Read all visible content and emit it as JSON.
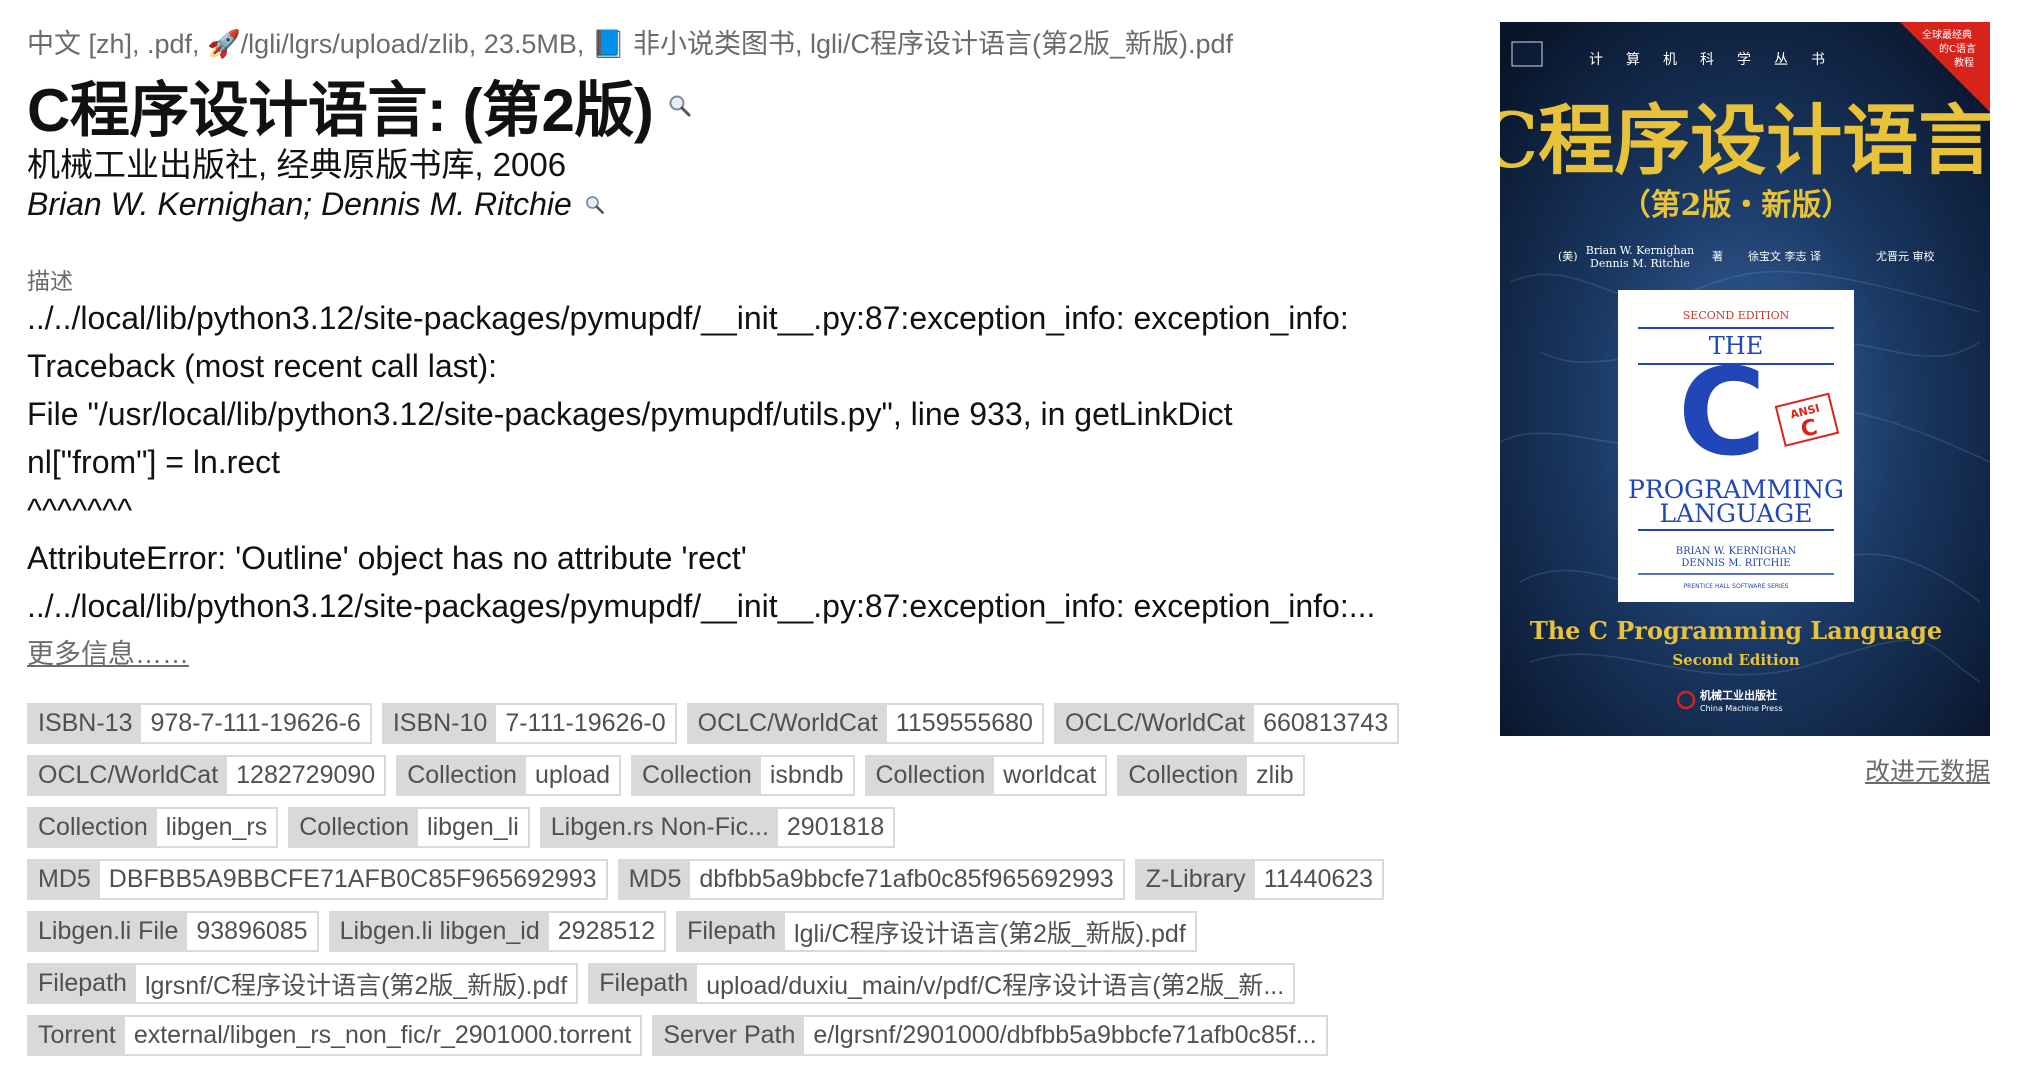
{
  "meta_line": "中文 [zh], .pdf, 🚀/lgli/lgrs/upload/zlib, 23.5MB, 📘 非小说类图书, lgli/C程序设计语言(第2版_新版).pdf",
  "title": "C程序设计语言: (第2版)",
  "publisher": "机械工业出版社, 经典原版书库, 2006",
  "authors": "Brian W. Kernighan; Dennis M. Ritchie",
  "description_label": "描述",
  "description_lines": [
    "../../local/lib/python3.12/site-packages/pymupdf/__init__.py:87:exception_info: exception_info:",
    "Traceback (most recent call last):",
    "File \"/usr/local/lib/python3.12/site-packages/pymupdf/utils.py\", line 933, in getLinkDict",
    "nl[\"from\"] = ln.rect",
    "^^^^^^^",
    "AttributeError: 'Outline' object has no attribute 'rect'",
    "../../local/lib/python3.12/site-packages/pymupdf/__init__.py:87:exception_info: exception_info:..."
  ],
  "more_link": "更多信息……",
  "improve_link": "改进元数据",
  "tags": [
    [
      {
        "k": "ISBN-13",
        "v": "978-7-111-19626-6"
      },
      {
        "k": "ISBN-10",
        "v": "7-111-19626-0"
      },
      {
        "k": "OCLC/WorldCat",
        "v": "1159555680"
      },
      {
        "k": "OCLC/WorldCat",
        "v": "660813743"
      }
    ],
    [
      {
        "k": "OCLC/WorldCat",
        "v": "1282729090"
      },
      {
        "k": "Collection",
        "v": "upload"
      },
      {
        "k": "Collection",
        "v": "isbndb"
      },
      {
        "k": "Collection",
        "v": "worldcat"
      },
      {
        "k": "Collection",
        "v": "zlib"
      }
    ],
    [
      {
        "k": "Collection",
        "v": "libgen_rs"
      },
      {
        "k": "Collection",
        "v": "libgen_li"
      },
      {
        "k": "Libgen.rs Non-Fic...",
        "v": "2901818"
      }
    ],
    [
      {
        "k": "MD5",
        "v": "DBFBB5A9BBCFE71AFB0C85F965692993"
      },
      {
        "k": "MD5",
        "v": "dbfbb5a9bbcfe71afb0c85f965692993"
      },
      {
        "k": "Z-Library",
        "v": "11440623"
      }
    ],
    [
      {
        "k": "Libgen.li File",
        "v": "93896085"
      },
      {
        "k": "Libgen.li libgen_id",
        "v": "2928512"
      },
      {
        "k": "Filepath",
        "v": "lgli/C程序设计语言(第2版_新版).pdf"
      }
    ],
    [
      {
        "k": "Filepath",
        "v": "lgrsnf/C程序设计语言(第2版_新版).pdf"
      },
      {
        "k": "Filepath",
        "v": "upload/duxiu_main/v/pdf/C程序设计语言(第2版_新..."
      }
    ],
    [
      {
        "k": "Torrent",
        "v": "external/libgen_rs_non_fic/r_2901000.torrent"
      },
      {
        "k": "Server Path",
        "v": "e/lgrsnf/2901000/dbfbb5a9bbcfe71afb0c85f..."
      }
    ]
  ],
  "cover": {
    "series_chars": [
      "计",
      "算",
      "机",
      "科",
      "学",
      "丛",
      "书"
    ],
    "corner_badge": [
      "全球最经典",
      "的C语言",
      "教程"
    ],
    "cn_title": "C程序设计语言",
    "cn_edition": "（第2版・新版）",
    "authors_en": [
      "Brian W. Kernighan",
      "Dennis M. Ritchie"
    ],
    "author_prefix": "(美)",
    "author_suffix": "著",
    "translators": "徐宝文  李志  译",
    "reviewer": "尤晋元  审校",
    "inner_edition": "SECOND EDITION",
    "inner_the": "THE",
    "inner_c": "C",
    "inner_ansi": "ANSI",
    "inner_ansi_c": "C",
    "inner_lang1": "PROGRAMMING",
    "inner_lang2": "LANGUAGE",
    "inner_authors": [
      "BRIAN W. KERNIGHAN",
      "DENNIS M. RITCHIE"
    ],
    "inner_series": "PRENTICE HALL SOFTWARE SERIES",
    "en_title": "The C Programming Language",
    "en_edition": "Second Edition",
    "publisher_cn": "机械工业出版社",
    "publisher_en": "China Machine Press",
    "colors": {
      "gold": "#e8c23a",
      "red": "#d8231c",
      "blue": "#2146b8",
      "deep": "#0b1c38"
    }
  }
}
